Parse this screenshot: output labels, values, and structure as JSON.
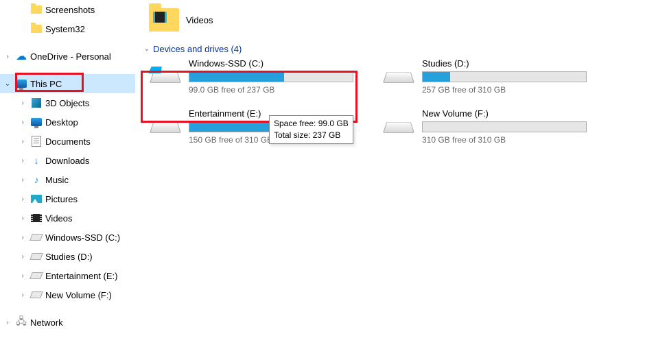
{
  "sidebar": {
    "items": [
      {
        "label": "Screenshots",
        "icon": "folder",
        "indent": 1,
        "chev": "none"
      },
      {
        "label": "System32",
        "icon": "folder",
        "indent": 1,
        "chev": "none"
      },
      {
        "label": "OneDrive - Personal",
        "icon": "cloud",
        "indent": 0,
        "chev": "closed"
      },
      {
        "label": "This PC",
        "icon": "monitor",
        "indent": 0,
        "chev": "open",
        "selected": true,
        "highlight": true
      },
      {
        "label": "3D Objects",
        "icon": "obj3d",
        "indent": 1,
        "chev": "closed"
      },
      {
        "label": "Desktop",
        "icon": "monitor",
        "indent": 1,
        "chev": "closed"
      },
      {
        "label": "Documents",
        "icon": "docicon",
        "indent": 1,
        "chev": "closed"
      },
      {
        "label": "Downloads",
        "icon": "dl",
        "indent": 1,
        "chev": "closed"
      },
      {
        "label": "Music",
        "icon": "music",
        "indent": 1,
        "chev": "closed"
      },
      {
        "label": "Pictures",
        "icon": "picicon",
        "indent": 1,
        "chev": "closed"
      },
      {
        "label": "Videos",
        "icon": "videoicon",
        "indent": 1,
        "chev": "closed"
      },
      {
        "label": "Windows-SSD (C:)",
        "icon": "diskicon",
        "indent": 1,
        "chev": "closed"
      },
      {
        "label": "Studies (D:)",
        "icon": "diskicon",
        "indent": 1,
        "chev": "closed"
      },
      {
        "label": "Entertainment (E:)",
        "icon": "diskicon",
        "indent": 1,
        "chev": "closed"
      },
      {
        "label": "New Volume (F:)",
        "icon": "diskicon",
        "indent": 1,
        "chev": "closed"
      },
      {
        "label": "Network",
        "icon": "netw",
        "indent": 0,
        "chev": "closed"
      }
    ]
  },
  "content": {
    "top_folder": {
      "name": "Videos"
    },
    "section_header": "Devices and drives (4)",
    "drives": [
      {
        "name": "Windows-SSD (C:)",
        "free_text": "99.0 GB free of 237 GB",
        "fill_pct": 58,
        "win": true,
        "highlight": true
      },
      {
        "name": "Studies (D:)",
        "free_text": "257 GB free of 310 GB",
        "fill_pct": 17,
        "win": false
      },
      {
        "name": "Entertainment (E:)",
        "free_text": "150 GB free of 310 GB",
        "fill_pct": 52,
        "win": false
      },
      {
        "name": "New Volume (F:)",
        "free_text": "310 GB free of 310 GB",
        "fill_pct": 0,
        "win": false
      }
    ],
    "tooltip": {
      "line1": "Space free: 99.0 GB",
      "line2": "Total size: 237 GB"
    }
  }
}
